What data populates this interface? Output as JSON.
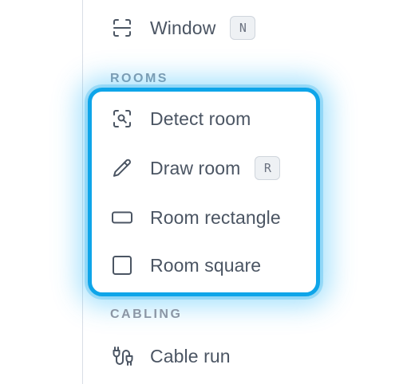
{
  "items": {
    "window": {
      "label": "Window",
      "shortcut": "N",
      "icon": "window-scan-icon"
    },
    "detect_room": {
      "label": "Detect room",
      "icon": "scan-search-icon"
    },
    "draw_room": {
      "label": "Draw room",
      "shortcut": "R",
      "icon": "pencil-icon"
    },
    "room_rectangle": {
      "label": "Room rectangle",
      "icon": "rectangle-icon"
    },
    "room_square": {
      "label": "Room square",
      "icon": "square-icon"
    },
    "cable_run": {
      "label": "Cable run",
      "icon": "cable-icon"
    }
  },
  "sections": {
    "rooms": "ROOMS",
    "cabling": "CABLING"
  },
  "colors": {
    "highlight": "#0ea5e9",
    "text": "#4b5563",
    "section_text": "#8b96a5"
  }
}
